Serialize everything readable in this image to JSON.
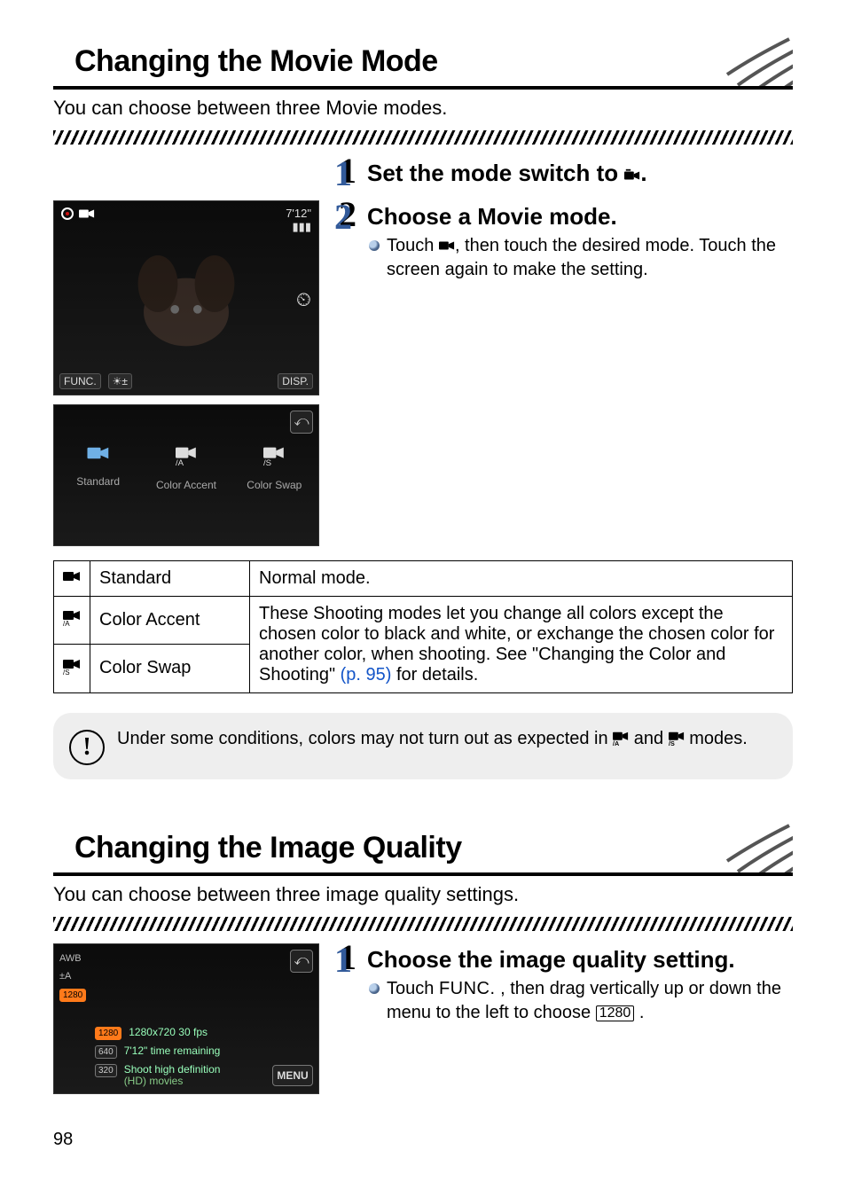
{
  "section1": {
    "title": "Changing the Movie Mode",
    "intro": "You can choose between three Movie modes.",
    "step1_title_before": "Set the mode switch to ",
    "step1_title_after": ".",
    "step2_title": "Choose a Movie mode.",
    "step2_bullet_before": "Touch ",
    "step2_bullet_after": ", then touch the desired mode. Touch the screen again to make the setting."
  },
  "shot1": {
    "rec_indicator": "",
    "time": "7'12\"",
    "battery": "",
    "mid_timer": "⏲",
    "func": "FUNC.",
    "exp": "☀±",
    "disp": "DISP."
  },
  "modes_preview": {
    "back": "⤺",
    "items": [
      {
        "label": "Standard"
      },
      {
        "label": "Color Accent"
      },
      {
        "label": "Color Swap"
      }
    ]
  },
  "table": {
    "r1_name": "Standard",
    "r1_desc": "Normal mode.",
    "r2_name": "Color Accent",
    "r3_name": "Color Swap",
    "r23_desc_before": "These Shooting modes let you change all colors except the chosen color to black and white, or exchange the chosen color for another color, when shooting. See \"Changing the Color and Shooting\" ",
    "r23_link": "(p. 95)",
    "r23_desc_after": " for details."
  },
  "caution": {
    "text_before": "Under some conditions, colors may not turn out as expected in ",
    "icon_a": "",
    "and": " and ",
    "icon_s": "",
    "text_after": " modes."
  },
  "section2": {
    "title": "Changing the Image Quality",
    "intro": "You can choose between three image quality settings.",
    "step1_title": "Choose the image quality setting.",
    "bullet_a": "Touch ",
    "func_label": "FUNC.",
    "bullet_b": ", then drag vertically up or down the menu to the left to choose ",
    "chip": "1280",
    "bullet_c": " ."
  },
  "shot3": {
    "left_labels": [
      "AWB",
      "±A",
      "1280"
    ],
    "opt1_chip": "1280",
    "opt1_main": "1280x720 30 fps",
    "opt2_chip": "640",
    "opt2_main": "7'12\" time remaining",
    "opt3_chip": "320",
    "opt3_main": "Shoot high definition",
    "opt3_sub": "(HD) movies",
    "back": "⤺",
    "menu": "MENU"
  },
  "page_number": "98"
}
